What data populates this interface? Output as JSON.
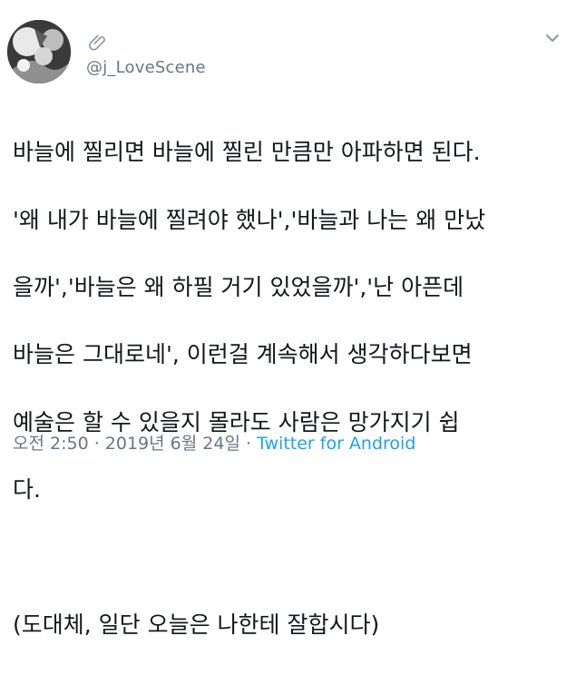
{
  "tweet": {
    "handle": "@j_LoveScene",
    "body_lines": [
      "바늘에 찔리면 바늘에 찔린 만큼만 아파하면 된다.",
      "'왜 내가 바늘에 찔려야 했나','바늘과 나는 왜 만났",
      "을까','바늘은 왜 하필 거기 있었을까','난 아픈데",
      "바늘은 그대로네', 이런걸 계속해서 생각하다보면",
      "예술은 할 수 있을지 몰라도 사람은 망가지기 쉽",
      "다.",
      "",
      "(도대체, 일단 오늘은 나한테 잘합시다)"
    ],
    "timestamp": "오전 2:50 · 2019년 6월 24일 · ",
    "source": "Twitter for Android"
  },
  "icons": {
    "badge": "paperclip-icon",
    "menu": "chevron-down-icon"
  },
  "colors": {
    "text": "#14171a",
    "secondary": "#657786",
    "link": "#1da1f2"
  }
}
